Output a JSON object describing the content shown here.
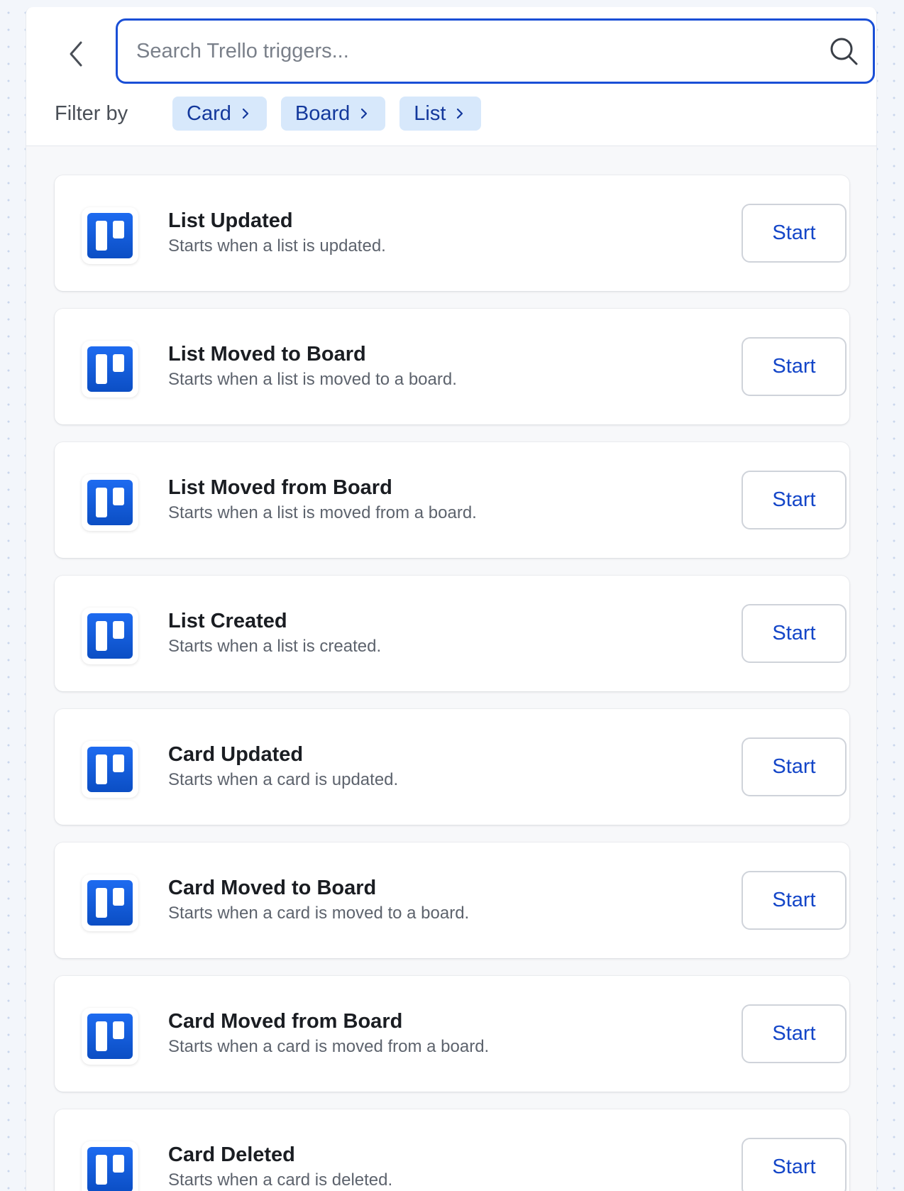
{
  "search": {
    "placeholder": "Search Trello triggers...",
    "value": ""
  },
  "filter": {
    "label": "Filter by",
    "chips": [
      {
        "label": "Card"
      },
      {
        "label": "Board"
      },
      {
        "label": "List"
      }
    ]
  },
  "triggers": [
    {
      "title": "List Updated",
      "description": "Starts when a list is updated.",
      "button": "Start"
    },
    {
      "title": "List Moved to Board",
      "description": "Starts when a list is moved to a board.",
      "button": "Start"
    },
    {
      "title": "List Moved from Board",
      "description": "Starts when a list is moved from a board.",
      "button": "Start"
    },
    {
      "title": "List Created",
      "description": "Starts when a list is created.",
      "button": "Start"
    },
    {
      "title": "Card Updated",
      "description": "Starts when a card is updated.",
      "button": "Start"
    },
    {
      "title": "Card Moved to Board",
      "description": "Starts when a card is moved to a board.",
      "button": "Start"
    },
    {
      "title": "Card Moved from Board",
      "description": "Starts when a card is moved from a board.",
      "button": "Start"
    },
    {
      "title": "Card Deleted",
      "description": "Starts when a card is deleted.",
      "button": "Start"
    }
  ],
  "icons": {
    "back": "chevron-left-icon",
    "search": "search-icon",
    "chip": "chevron-right-icon",
    "trigger": "trello-logo-icon"
  },
  "colors": {
    "accent": "#1a4fd6",
    "chip_bg": "#d7e8fb",
    "chip_text": "#13389c",
    "trello_blue": "#0b4ec4"
  }
}
